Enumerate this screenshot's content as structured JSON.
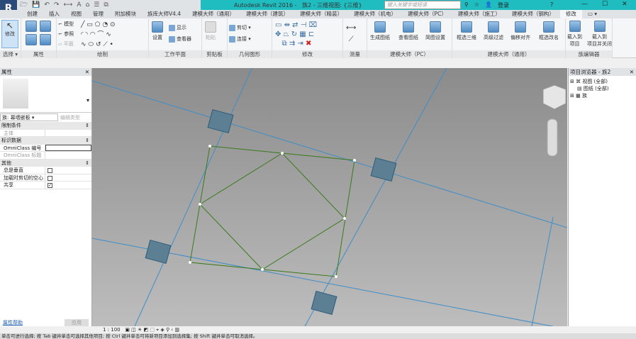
{
  "titlebar": {
    "app_title": "Autodesk Revit 2016 -",
    "doc_title": "族2 - 三维视图: {三维}",
    "search_placeholder": "键入关键字或短语",
    "login": "登录",
    "help": "?",
    "min": "—",
    "max": "☐",
    "close": "✕"
  },
  "tabs": [
    "创建",
    "插入",
    "视图",
    "管理",
    "附加模块",
    "族库大师V4.4",
    "建模大师（通用）",
    "建模大师（建筑）",
    "建模大师（精装）",
    "建模大师（机电）",
    "建模大师（PC）",
    "建模大师（施工）",
    "建模大师（钢构）",
    "修改",
    "▭ ▾"
  ],
  "ribbon": {
    "modify": "修改",
    "select": "选择 ▾",
    "properties": "属性",
    "draw": {
      "model": "模型",
      "ref": "参照",
      "plane": "平面",
      "label": "绘制"
    },
    "workplane": {
      "set": "设置",
      "show": "显示",
      "viewer": "查看器",
      "label": "工作平面"
    },
    "clipboard": {
      "paste": "粘贴",
      "label": "剪贴板"
    },
    "geometry": {
      "cut": "剪切",
      "join": "连接",
      "label": "几何图形"
    },
    "modify_group": "修改",
    "measure": "测量",
    "pc": {
      "gen": "生成图纸",
      "view": "查看图纸",
      "setup": "简图设置",
      "label": "建模大师（PC）"
    },
    "general": {
      "b1": "框选三维",
      "b2": "高级过滤",
      "b3": "偏移对齐",
      "b4": "框选改名",
      "label": "建模大师（通用）"
    },
    "family_editor": {
      "load": "载入到\n项目",
      "load_close": "载入到\n项目并关闭",
      "label": "族编辑器"
    }
  },
  "properties": {
    "title": "属性",
    "type_selector": "族: 幕墙嵌板",
    "edit_type": "编辑类型",
    "sections": [
      {
        "name": "限制条件",
        "rows": [
          {
            "k": "主体",
            "v": ""
          }
        ]
      },
      {
        "name": "标识数据",
        "rows": [
          {
            "k": "OmniClass 编号",
            "v": ""
          },
          {
            "k": "OmniClass 标题",
            "v": ""
          }
        ]
      },
      {
        "name": "其他",
        "rows": [
          {
            "k": "总是垂直",
            "check": false
          },
          {
            "k": "加载时剪切的空心",
            "check": false
          },
          {
            "k": "共享",
            "check": true
          }
        ]
      }
    ],
    "help_link": "属性帮助",
    "apply": "应用"
  },
  "browser": {
    "title": "项目浏览器 - 族2",
    "items": [
      "视图 (全部)",
      "图纸 (全部)",
      "族"
    ]
  },
  "viewbar": {
    "scale": "1 : 100"
  },
  "status": "单击可进行选择; 按 Tab 键并单击可选择其他项目; 按 Ctrl 键并单击可将新项目添加到选择集; 按 Shift 键并单击可取消选择。",
  "colors": {
    "accent": "#1fbcc0",
    "grid": "#3e8ec7",
    "geometry": "#3a7a1a"
  }
}
